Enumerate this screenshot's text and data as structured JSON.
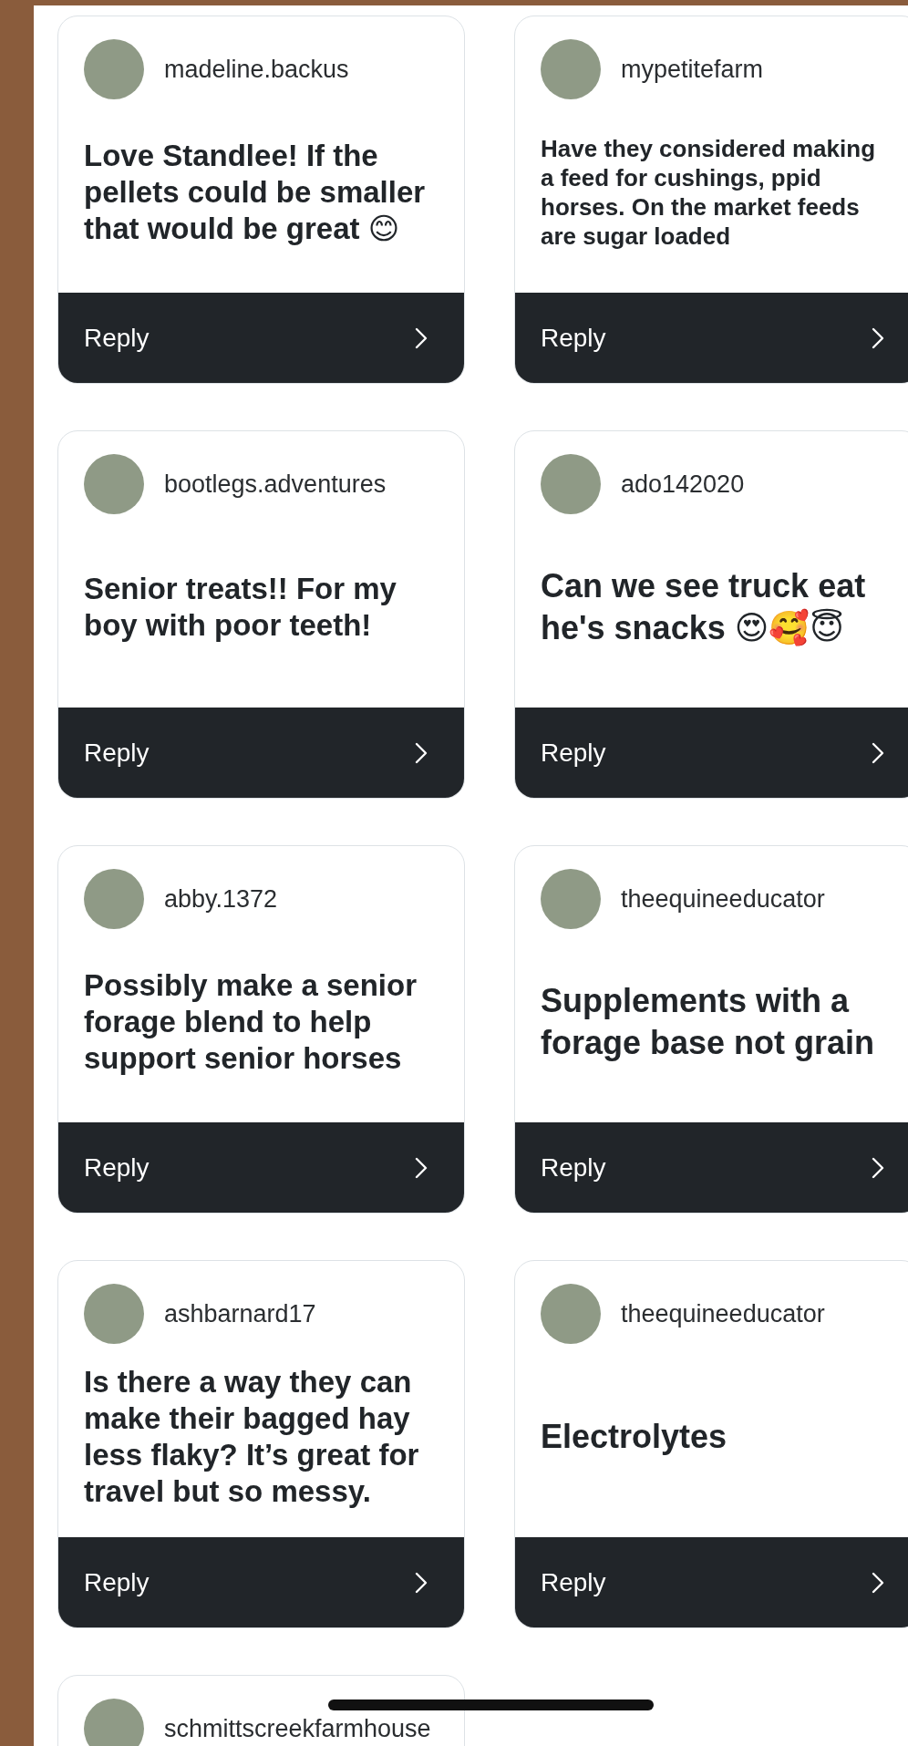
{
  "cards": [
    {
      "username": "madeline.backus",
      "comment": "Love Standlee! If the pellets could be smaller that would be great 😊",
      "kind": "medium",
      "reply": "Reply"
    },
    {
      "username": "mypetitefarm",
      "comment": "Have they considered making a feed for cushings, ppid horses. On the market feeds are sugar loaded",
      "kind": "small",
      "reply": "Reply"
    },
    {
      "username": "bootlegs.adventures",
      "comment": "Senior treats!! For my boy with poor teeth!",
      "kind": "medium",
      "reply": "Reply"
    },
    {
      "username": "ado142020",
      "comment": "Can we see truck eat he's snacks 😍🥰😇",
      "kind": "large",
      "reply": "Reply"
    },
    {
      "username": "abby.1372",
      "comment": "Possibly make a senior forage blend to help support senior horses",
      "kind": "medium",
      "reply": "Reply"
    },
    {
      "username": "theequineeducator",
      "comment": "Supplements with a forage base not grain",
      "kind": "large",
      "reply": "Reply"
    },
    {
      "username": "ashbarnard17",
      "comment": "Is there a way they can make their bagged hay less flaky? It’s great for travel but so messy.",
      "kind": "medium",
      "reply": "Reply"
    },
    {
      "username": "theequineeducator",
      "comment": "Electrolytes",
      "kind": "large",
      "reply": "Reply"
    },
    {
      "username": "schmittscreekfarmhouse"
    }
  ]
}
